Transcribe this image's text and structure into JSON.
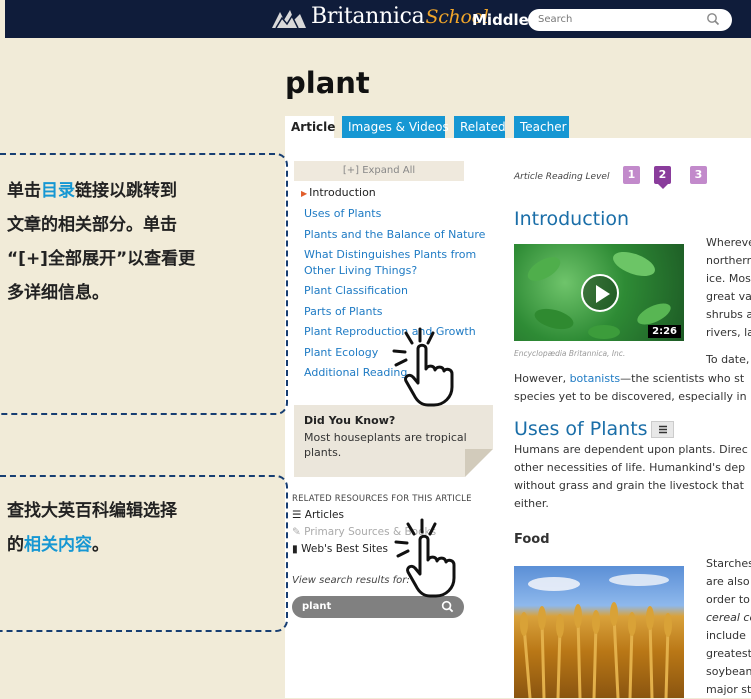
{
  "header": {
    "brand_name": "Britannica",
    "brand_school": "School",
    "brand_level": "Middle",
    "search_placeholder": "Search"
  },
  "page": {
    "title": "plant"
  },
  "tabs": [
    {
      "label": "Article"
    },
    {
      "label": "Images & Videos"
    },
    {
      "label": "Related"
    },
    {
      "label": "Teacher"
    }
  ],
  "toc": {
    "expand_all": "[+] Expand All",
    "items": [
      {
        "label": "Introduction"
      },
      {
        "label": "Uses of Plants"
      },
      {
        "label": "Plants and the Balance of Nature"
      },
      {
        "label": "What Distinguishes Plants from"
      },
      {
        "label": "Other Living Things?"
      },
      {
        "label": "Plant Classification"
      },
      {
        "label": "Parts of Plants"
      },
      {
        "label": "Plant Reproduction and Growth"
      },
      {
        "label": "Plant Ecology"
      },
      {
        "label": "Additional Reading"
      }
    ]
  },
  "did_you_know": {
    "title": "Did You Know?",
    "text": "Most houseplants are tropical plants."
  },
  "related_resources": {
    "heading": "RELATED RESOURCES FOR THIS ARTICLE",
    "items": [
      {
        "label": "Articles"
      },
      {
        "label": "Primary Sources & Books"
      },
      {
        "label": "Web's Best Sites"
      }
    ],
    "view_search_results": "View search results for:",
    "search_term": "plant"
  },
  "article": {
    "reading_level_label": "Article Reading Level",
    "levels": [
      "1",
      "2",
      "3"
    ],
    "intro_heading": "Introduction",
    "video_duration": "2:26",
    "video_caption": "Encyclopædia Britannica, Inc.",
    "intro_lines": [
      "Whereve",
      "northern",
      "ice. Mos",
      "great va",
      "shrubs a",
      "rivers, la"
    ],
    "to_date": "To date,",
    "however_1": "However, ",
    "however_link": "botanists",
    "however_2": "—the scientists who st",
    "however_line2": "species yet to be discovered, especially in",
    "uses_heading": "Uses of Plants",
    "uses_lines": [
      "Humans are dependent upon plants. Direc",
      "other necessities of life. Humankind's dep",
      "without grass and grain the livestock that",
      "either."
    ],
    "food_heading": "Food",
    "food_lines": [
      "Starches",
      "are also",
      "order to",
      "cereal co",
      "include",
      "greatest",
      "soybean",
      "major st"
    ]
  },
  "callouts": {
    "c1_line1_a": "单击",
    "c1_line1_hl": "目录",
    "c1_line1_b": "链接以跳转到",
    "c1_line2": "文章的相关部分。单击",
    "c1_line3": "“[+]全部展开”以查看更",
    "c1_line4": "多详细信息。",
    "c2_line1": "查找大英百科编辑选择",
    "c2_line2_a": "的",
    "c2_line2_hl": "相关内容",
    "c2_line2_b": "。"
  },
  "colors": {
    "header_bg": "#0f1c3a",
    "tab_blue": "#1697d3",
    "heading_blue": "#1a6ea8",
    "level_purple": "#8a3c9c",
    "callout_border": "#173e72",
    "page_bg": "#f1ebd8"
  }
}
